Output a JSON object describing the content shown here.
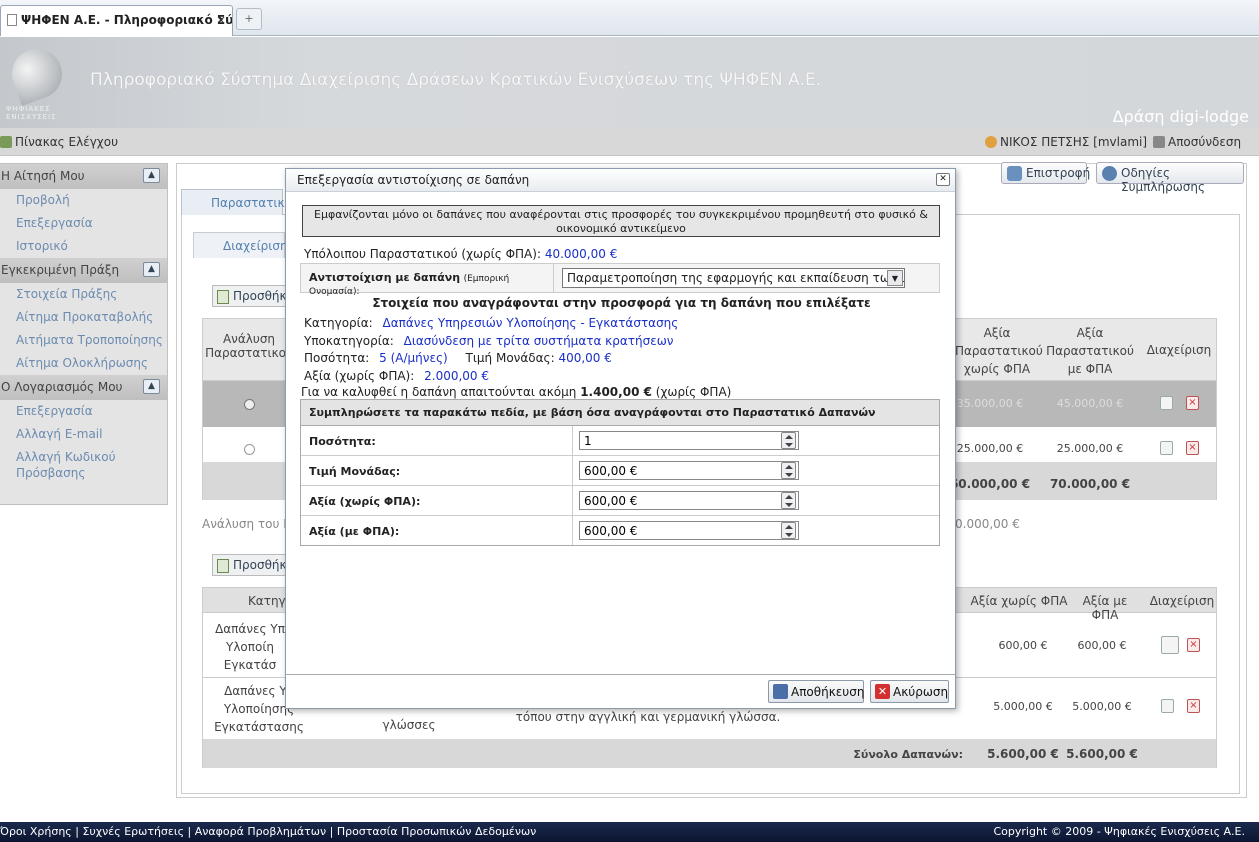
{
  "browser": {
    "tab_title": "ΨΗΦΕΝ Α.Ε. - Πληροφοριακό Σύστη...",
    "tab_close": "×",
    "new_tab": "+"
  },
  "banner": {
    "title": "Πληροφοριακό Σύστημα Διαχείρισης Δράσεων Κρατικών Ενισχύσεων της ΨΗΦΕΝ Α.Ε.",
    "action": "Δράση digi-lodge",
    "logo_text_1": "ΨΗΦΙΑΚΕΣ",
    "logo_text_2": "ΕΝΙΣΧΥΣΕΙΣ"
  },
  "topnav": {
    "dashboard": "Πίνακας Ελέγχου",
    "user": "ΝΙΚΟΣ ΠΕΤΣΗΣ [mvlami]",
    "logout": "Αποσύνδεση"
  },
  "sidebar": {
    "sections": [
      {
        "title": "Η Αίτησή Μου",
        "items": [
          "Προβολή",
          "Επεξεργασία",
          "Ιστορικό"
        ]
      },
      {
        "title": "Εγκεκριμένη Πράξη",
        "items": [
          "Στοιχεία Πράξης",
          "Αίτημα Προκαταβολής",
          "Αιτήματα Τροποποίησης",
          "Αίτημα Ολοκλήρωσης"
        ]
      },
      {
        "title": "Ο Λογαριασμός Μου",
        "items": [
          "Επεξεργασία",
          "Αλλαγή E-mail",
          "Αλλαγή Κωδικού Πρόσβασης"
        ]
      }
    ],
    "collapse_glyph": "▲"
  },
  "main": {
    "outer_tab": "Παραστατικά",
    "inner_tab": "Διαχείριση",
    "back_button": "Επιστροφή",
    "help_button": "Οδηγίες Συμπλήρωσης",
    "add_button": "Προσθήκη",
    "table1": {
      "headers": [
        "Ανάλυση Παραστατικού",
        "Αξία Παραστατικού χωρίς ΦΠΑ",
        "Αξία Παραστατικού με ΦΠΑ",
        "Διαχείριση"
      ],
      "rows": [
        {
          "no_vat": "35.000,00 €",
          "with_vat": "45.000,00 €"
        },
        {
          "no_vat": "25.000,00 €",
          "with_vat": "25.000,00 €"
        }
      ],
      "total_no_vat": "60.000,00 €",
      "total_with_vat": "70.000,00 €"
    },
    "analysis_label": "Ανάλυση του Π",
    "analysis_value": "0.000,00 €",
    "table2": {
      "headers": [
        "Κατηγο",
        "Αξία χωρίς ΦΠΑ",
        "Αξία με ΦΠΑ",
        "Διαχείριση"
      ],
      "rows": [
        {
          "category": "Δαπάνες Υπ Υλοποίη Εγκατάσ",
          "no_vat": "600,00 €",
          "with_vat": "600,00 €"
        },
        {
          "category": "Δαπάνες Υπ Υλοποίησης Εγκατάστασης",
          "sub": "γλώσσες",
          "desc": "τόπου στην αγγλική και γερμανική γλώσσα.",
          "no_vat": "5.000,00 €",
          "with_vat": "5.000,00 €"
        }
      ],
      "total_label": "Σύνολο Δαπανών:",
      "total_no_vat": "5.600,00 €",
      "total_with_vat": "5.600,00 €"
    }
  },
  "modal": {
    "title": "Επεξεργασία αντιστοίχισης σε δαπάνη",
    "close": "✕",
    "notice": "Εμφανίζονται μόνο οι δαπάνες που αναφέρονται στις προσφορές του συγκεκριμένου προμηθευτή στο φυσικό & οικονομικό αντικείμενο",
    "remaining_label": "Υπόλοιπου Παραστατικού (χωρίς ΦΠΑ):",
    "remaining_value": "40.000,00 €",
    "mapping_label": "Αντιστοίχιση με δαπάνη",
    "mapping_hint": "(Εμπορική Ονομασία):",
    "mapping_selected": "Παραμετροποίηση της εφαρμογής και εκπαίδευση των υπα",
    "offer_heading": "Στοιχεία που αναγράφονται στην προσφορά για τη δαπάνη που επιλέξατε",
    "category_label": "Κατηγορία:",
    "category_value": "Δαπάνες Υπηρεσιών Υλοποίησης - Εγκατάστασης",
    "subcategory_label": "Υποκατηγορία:",
    "subcategory_value": "Διασύνδεση με τρίτα συστήματα κρατήσεων",
    "quantity_label": "Ποσότητα:",
    "quantity_value": "5 (Α/μήνες)",
    "unit_price_label": "Τιμή Μονάδας:",
    "unit_price_value": "400,00 €",
    "value_label": "Αξία (χωρίς ΦΠΑ):",
    "value_value": "2.000,00 €",
    "remaining_text_1": "Για να καλυφθεί η δαπάνη απαιτούνται ακόμη",
    "remaining_amount": "1.400,00 €",
    "remaining_text_2": "(χωρίς ΦΠΑ)",
    "form_heading": "Συμπληρώσετε τα παρακάτω πεδία, με βάση όσα αναγράφονται στο Παραστατικό Δαπανών",
    "fields": [
      {
        "label": "Ποσότητα:",
        "value": "1"
      },
      {
        "label": "Τιμή Μονάδας:",
        "value": "600,00 €"
      },
      {
        "label": "Αξία (χωρίς ΦΠΑ):",
        "value": "600,00 €"
      },
      {
        "label": "Αξία (με ΦΠΑ):",
        "value": "600,00 €"
      }
    ],
    "save_button": "Αποθήκευση",
    "cancel_button": "Ακύρωση"
  },
  "footer": {
    "links": [
      "Όροι Χρήσης",
      "Συχνές Ερωτήσεις",
      "Αναφορά Προβλημάτων",
      "Προστασία Προσωπικών Δεδομένων"
    ],
    "separator": "|",
    "copyright": "Copyright © 2009 - Ψηφιακές Ενισχύσεις Α.Ε."
  },
  "colors": {
    "accent_link": "#1a30c8",
    "sidebar_link": "#6c8bb0",
    "footer_bg": "#0b1530"
  }
}
